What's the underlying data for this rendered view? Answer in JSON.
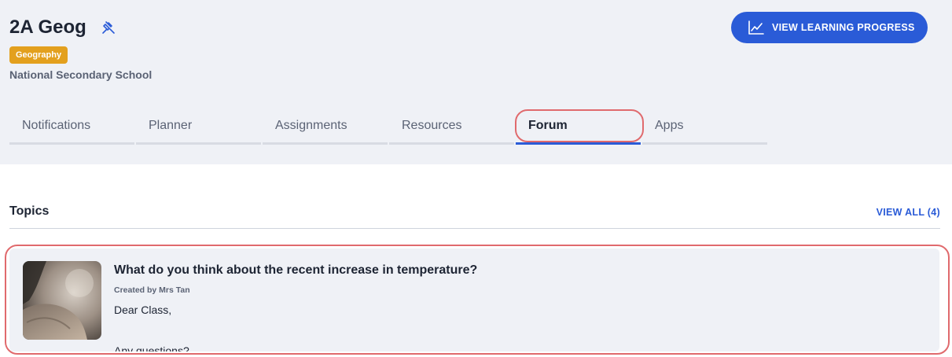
{
  "header": {
    "class_title": "2A Geog",
    "subject_badge": "Geography",
    "school_name": "National Secondary School",
    "progress_button_label": "VIEW LEARNING PROGRESS",
    "pin_icon": "pin-icon",
    "progress_icon": "line-chart-icon"
  },
  "tabs": [
    {
      "label": "Notifications",
      "active": false
    },
    {
      "label": "Planner",
      "active": false
    },
    {
      "label": "Assignments",
      "active": false
    },
    {
      "label": "Resources",
      "active": false
    },
    {
      "label": "Forum",
      "active": true
    },
    {
      "label": "Apps",
      "active": false
    }
  ],
  "topics": {
    "heading": "Topics",
    "view_all_label": "VIEW ALL (4)",
    "items": [
      {
        "title": "What do you think about the recent increase in temperature?",
        "author": "Created by Mrs Tan",
        "body_line_1": "Dear Class,",
        "body_line_2": "Any questions?"
      }
    ]
  },
  "colors": {
    "accent": "#2a5bd7",
    "badge": "#e3a01e",
    "header_bg": "#eff1f6",
    "highlight": "#e06a6d"
  }
}
